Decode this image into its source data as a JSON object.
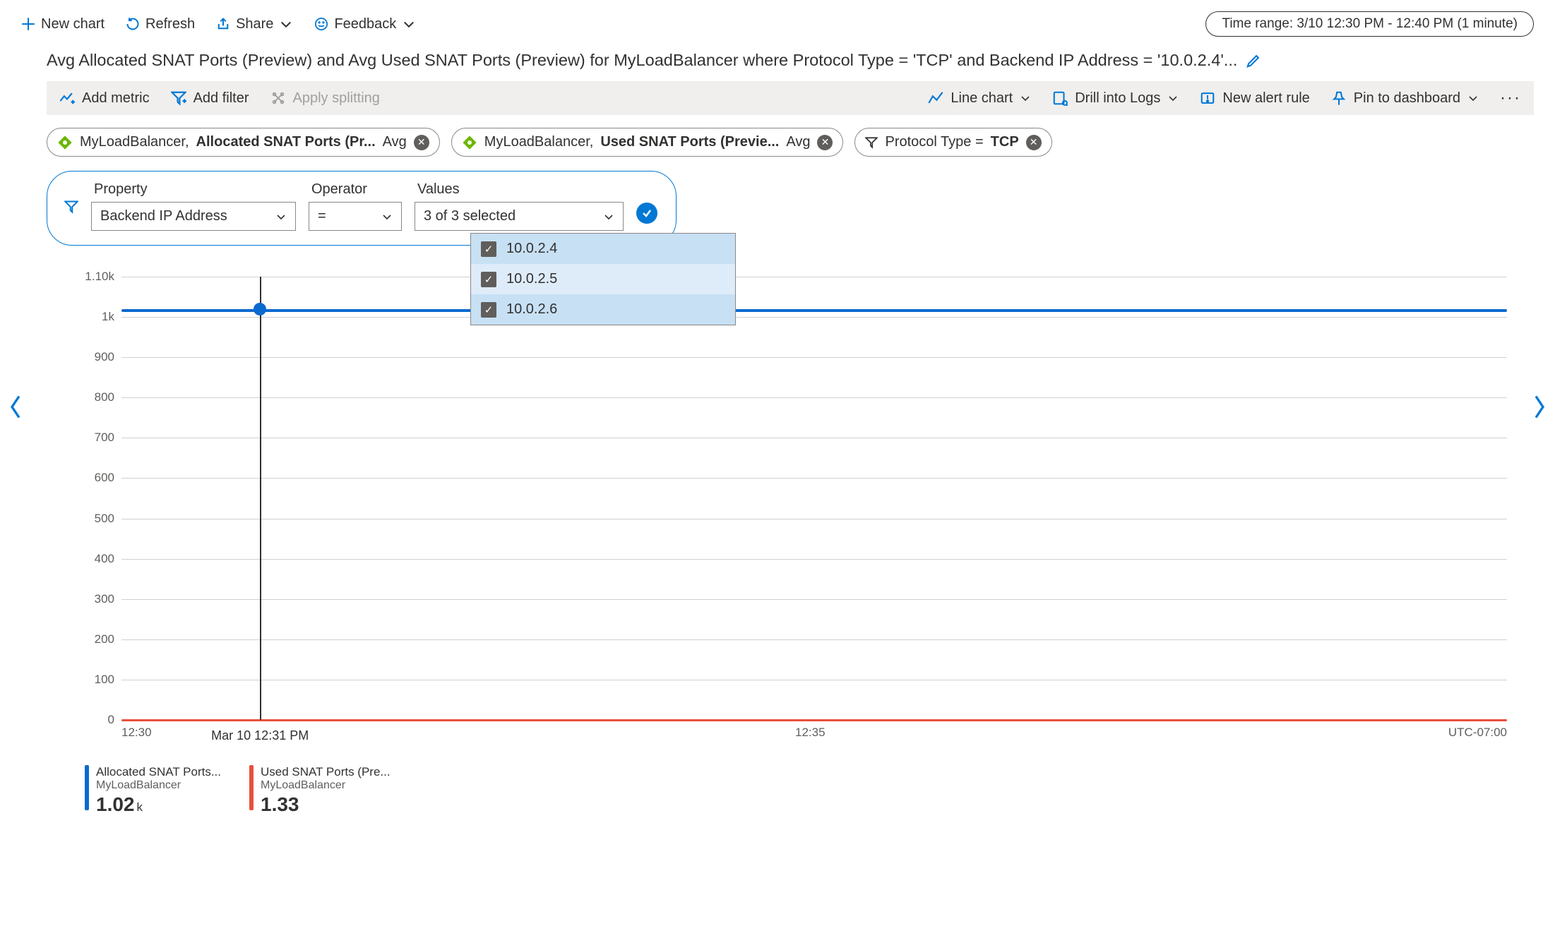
{
  "toolbar": {
    "new_chart": "New chart",
    "refresh": "Refresh",
    "share": "Share",
    "feedback": "Feedback",
    "time_range": "Time range: 3/10 12:30 PM - 12:40 PM (1 minute)"
  },
  "page_title": "Avg Allocated SNAT Ports (Preview) and Avg Used SNAT Ports (Preview) for MyLoadBalancer where Protocol Type = 'TCP' and Backend IP Address = '10.0.2.4'...",
  "metric_bar": {
    "add_metric": "Add metric",
    "add_filter": "Add filter",
    "apply_splitting": "Apply splitting",
    "line_chart": "Line chart",
    "drill_logs": "Drill into Logs",
    "new_alert": "New alert rule",
    "pin_dashboard": "Pin to dashboard"
  },
  "pills": [
    {
      "resource": "MyLoadBalancer,",
      "metric": "Allocated SNAT Ports (Pr...",
      "agg": "Avg"
    },
    {
      "resource": "MyLoadBalancer,",
      "metric": "Used SNAT Ports (Previe...",
      "agg": "Avg"
    }
  ],
  "filter_pill": {
    "label_pre": "Protocol Type =",
    "value": "TCP"
  },
  "filter_editor": {
    "property_label": "Property",
    "operator_label": "Operator",
    "values_label": "Values",
    "property_value": "Backend IP Address",
    "operator_value": "=",
    "values_value": "3 of 3 selected",
    "options": [
      "10.0.2.4",
      "10.0.2.5",
      "10.0.2.6"
    ]
  },
  "chart_data": {
    "type": "line",
    "x": [
      "12:30",
      "12:31",
      "12:32",
      "12:33",
      "12:34",
      "12:35",
      "12:36",
      "12:37",
      "12:38",
      "12:39",
      "12:40"
    ],
    "series": [
      {
        "name": "Allocated SNAT Ports",
        "values": [
          1020,
          1020,
          1020,
          1020,
          1020,
          1020,
          1020,
          1020,
          1020,
          1020,
          1020
        ],
        "color": "#0b6acf"
      },
      {
        "name": "Used SNAT Ports",
        "values": [
          1.33,
          1.33,
          1.33,
          1.33,
          1.33,
          1.33,
          1.33,
          1.33,
          1.33,
          1.33,
          1.33
        ],
        "color": "#e84f3d"
      }
    ],
    "y_ticks": [
      "0",
      "100",
      "200",
      "300",
      "400",
      "500",
      "600",
      "700",
      "800",
      "900",
      "1k",
      "1.10k"
    ],
    "ylim": [
      0,
      1100
    ],
    "x_ticks_shown": [
      "12:30",
      "12:35"
    ],
    "cursor_x": "12:31",
    "cursor_label": "Mar 10 12:31 PM",
    "timezone": "UTC-07:00"
  },
  "legend": [
    {
      "name": "Allocated SNAT Ports...",
      "sub": "MyLoadBalancer",
      "value": "1.02",
      "unit": "k"
    },
    {
      "name": "Used SNAT Ports (Pre...",
      "sub": "MyLoadBalancer",
      "value": "1.33",
      "unit": ""
    }
  ]
}
